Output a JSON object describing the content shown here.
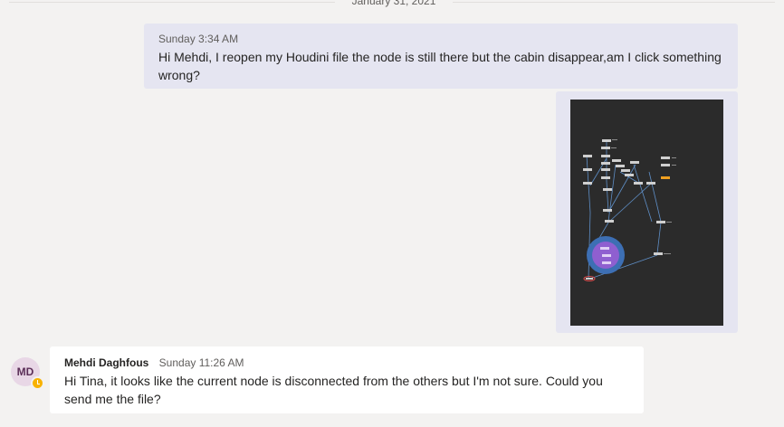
{
  "date_divider": {
    "label": "January 31, 2021"
  },
  "sent_message": {
    "time": "Sunday 3:34 AM",
    "text": "Hi Mehdi, I reopen my Houdini file the node is still there but the cabin disappear,am I click something wrong?"
  },
  "attachment": {
    "kind": "image",
    "description_icon": "node-graph-screenshot"
  },
  "received_message": {
    "avatar_initials": "MD",
    "presence_status": "away",
    "sender": "Mehdi Daghfous",
    "time": "Sunday 11:26 AM",
    "text": "Hi Tina, it looks like the current node is disconnected from the others but I'm not sure. Could you send me the file?"
  },
  "colors": {
    "background": "#f3f2f1",
    "sent_bubble": "#e5e5f1",
    "received_bubble": "#ffffff",
    "presence_away": "#f8b200"
  }
}
